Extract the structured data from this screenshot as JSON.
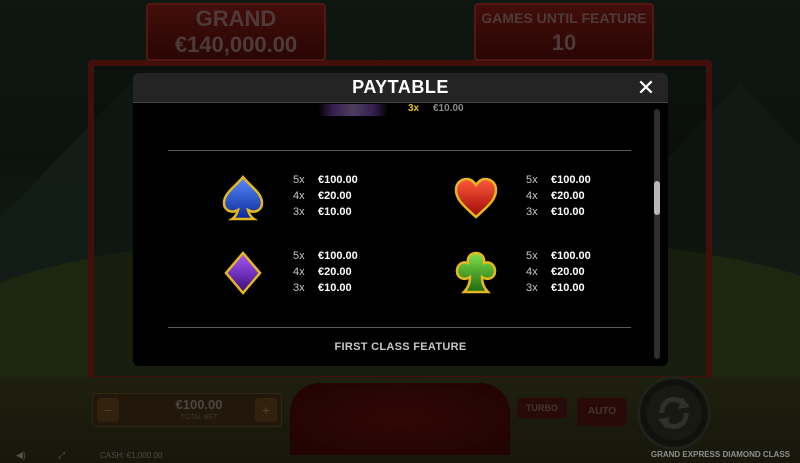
{
  "background": {
    "grand": {
      "label": "GRAND",
      "amount": "€140,000.00"
    },
    "games_until_feature": {
      "label": "GAMES UNTIL FEATURE",
      "value": "10"
    },
    "bet": {
      "value": "€100.00",
      "label": "TOTAL BET",
      "minus": "−",
      "plus": "+"
    },
    "turbo_label": "TURBO",
    "auto_label": "AUTO",
    "cash": "CASH: €1,000.00",
    "game_title": "GRAND EXPRESS DIAMOND CLASS"
  },
  "paytable": {
    "title": "PAYTABLE",
    "close_symbol": "✕",
    "partial_row": {
      "mult": "3x",
      "pay": "€10.00"
    },
    "symbols": [
      {
        "name": "spade",
        "icon": "spade-icon",
        "color": "#1a4fd0",
        "pays": [
          {
            "mult": "5x",
            "value": "€100.00"
          },
          {
            "mult": "4x",
            "value": "€20.00"
          },
          {
            "mult": "3x",
            "value": "€10.00"
          }
        ]
      },
      {
        "name": "heart",
        "icon": "heart-icon",
        "color": "#d4231a",
        "pays": [
          {
            "mult": "5x",
            "value": "€100.00"
          },
          {
            "mult": "4x",
            "value": "€20.00"
          },
          {
            "mult": "3x",
            "value": "€10.00"
          }
        ]
      },
      {
        "name": "diamond",
        "icon": "diamond-icon",
        "color": "#6a1fa8",
        "pays": [
          {
            "mult": "5x",
            "value": "€100.00"
          },
          {
            "mult": "4x",
            "value": "€20.00"
          },
          {
            "mult": "3x",
            "value": "€10.00"
          }
        ]
      },
      {
        "name": "club",
        "icon": "club-icon",
        "color": "#3f9a24",
        "pays": [
          {
            "mult": "5x",
            "value": "€100.00"
          },
          {
            "mult": "4x",
            "value": "€20.00"
          },
          {
            "mult": "3x",
            "value": "€10.00"
          }
        ]
      }
    ],
    "section_title": "FIRST CLASS FEATURE"
  }
}
